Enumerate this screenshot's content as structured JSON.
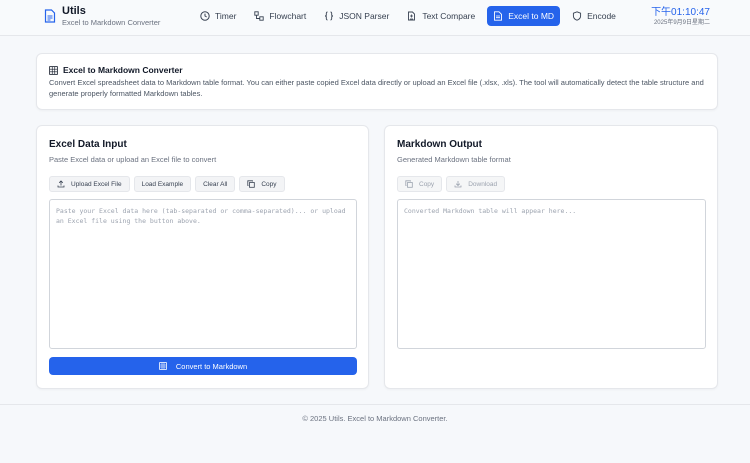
{
  "brand": {
    "name": "Utils",
    "subtitle": "Excel to Markdown Converter",
    "icon": "document-icon"
  },
  "nav": [
    {
      "label": "Timer",
      "icon": "clock-icon",
      "active": false
    },
    {
      "label": "Flowchart",
      "icon": "flowchart-icon",
      "active": false
    },
    {
      "label": "JSON Parser",
      "icon": "braces-icon",
      "active": false
    },
    {
      "label": "Text Compare",
      "icon": "compare-icon",
      "active": false
    },
    {
      "label": "Excel to MD",
      "icon": "file-text-icon",
      "active": true
    },
    {
      "label": "Encode",
      "icon": "shield-icon",
      "active": false
    }
  ],
  "clock": {
    "time": "下午01:10:47",
    "date": "2025年9月9日星期二"
  },
  "info": {
    "title": "Excel to Markdown Converter",
    "description": "Convert Excel spreadsheet data to Markdown table format. You can either paste copied Excel data directly or upload an Excel file (.xlsx, .xls). The tool will automatically detect the table structure and generate properly formatted Markdown tables."
  },
  "input_panel": {
    "title": "Excel Data Input",
    "subtitle": "Paste Excel data or upload an Excel file to convert",
    "buttons": {
      "upload": "Upload Excel File",
      "example": "Load Example",
      "clear": "Clear All",
      "copy": "Copy"
    },
    "placeholder": "Paste your Excel data here (tab-separated or comma-separated)... or upload an Excel file using the button above.",
    "convert_label": "Convert to Markdown"
  },
  "output_panel": {
    "title": "Markdown Output",
    "subtitle": "Generated Markdown table format",
    "buttons": {
      "copy": "Copy",
      "download": "Download"
    },
    "placeholder": "Converted Markdown table will appear here..."
  },
  "footer": {
    "text": "© 2025 Utils. Excel to Markdown Converter."
  },
  "colors": {
    "accent": "#2563eb",
    "background": "#f6f8fb",
    "border": "#e5e7eb"
  }
}
